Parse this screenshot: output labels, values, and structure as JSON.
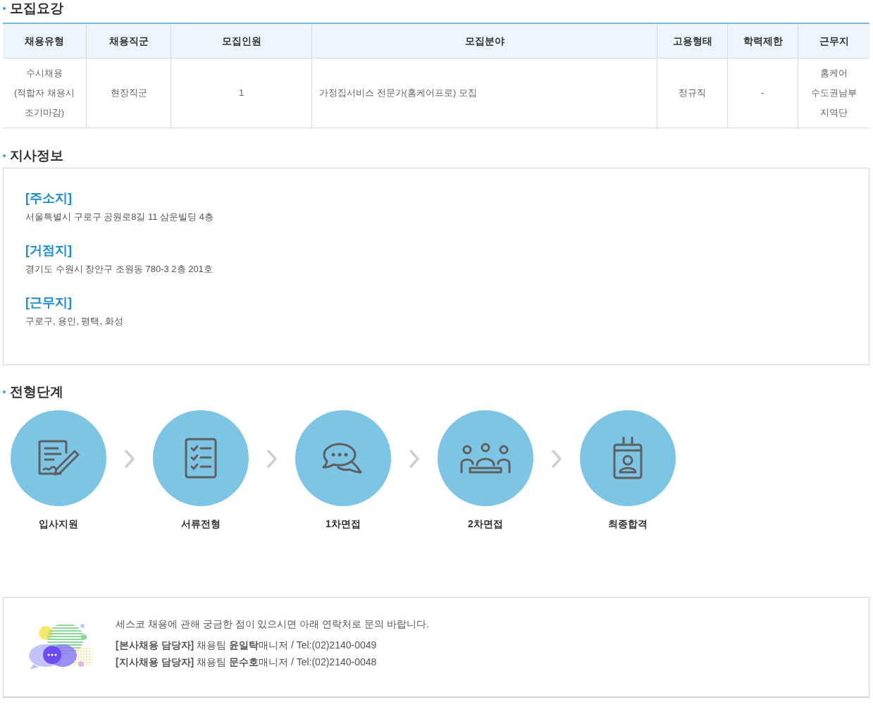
{
  "recruit": {
    "title": "모집요강",
    "columns": [
      "채용유형",
      "채용직군",
      "모집인원",
      "모집분야",
      "고용형태",
      "학력제한",
      "근무지"
    ],
    "row": [
      [
        "수시채용",
        "(적합자 채용시",
        "조기마감)"
      ],
      [
        "현장직군"
      ],
      [
        "1"
      ],
      [
        "가정집서비스 전문가(홈케어프로) 모집"
      ],
      [
        "정규직"
      ],
      [
        "-"
      ],
      [
        "홈케어",
        "수도권남부",
        "지역단"
      ]
    ]
  },
  "branch": {
    "title": "지사정보",
    "items": [
      {
        "label": "[주소지]",
        "text": "서울특별시 구로구 공원로8길 11 삼운빌딩 4층"
      },
      {
        "label": "[거점지]",
        "text": "경기도 수원시 장안구 조원동 780-3 2층 201호"
      },
      {
        "label": "[근무지]",
        "text": "구로구, 용인, 평택, 화성"
      }
    ]
  },
  "process": {
    "title": "전형단계",
    "steps": [
      {
        "kind": "application",
        "label": "입사지원"
      },
      {
        "kind": "checklist",
        "label": "서류전형"
      },
      {
        "kind": "chat",
        "label": "1차면접"
      },
      {
        "kind": "meeting",
        "label": "2차면접"
      },
      {
        "kind": "badge",
        "label": "최종합격"
      }
    ]
  },
  "contact": {
    "intro": "세스코 채용에 관해 궁금한 점이 있으시면 아래 연락처로 문의 바랍니다.",
    "lines": [
      "**[본사채용 담당자]** 채용팀 **윤일탁**매니저 / Tel:(02)2140-0049",
      "**[지사채용 담당자]** 채용팀 **문수호**매니저 / Tel:(02)2140-0048"
    ]
  }
}
